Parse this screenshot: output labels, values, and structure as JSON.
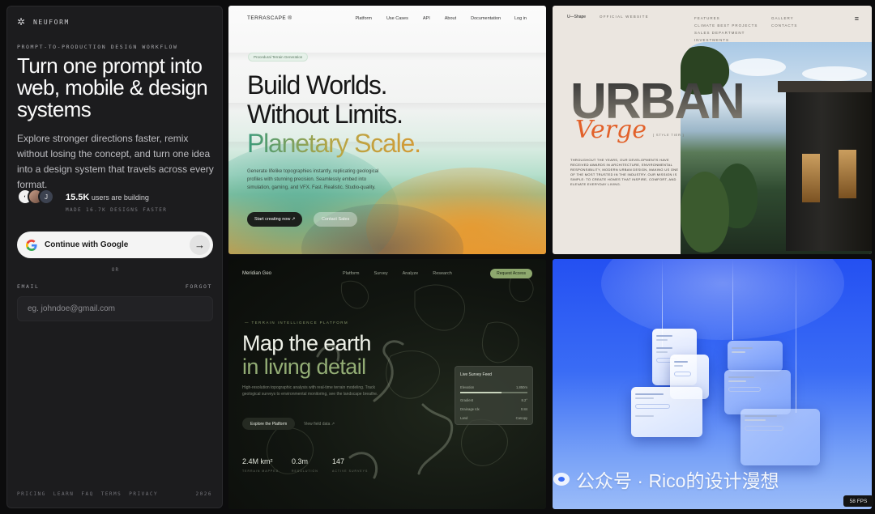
{
  "signin": {
    "brand_name": "NEUFORM",
    "eyebrow": "PROMPT-TO-PRODUCTION DESIGN WORKFLOW",
    "headline": "Turn one prompt into web, mobile & design systems",
    "description": "Explore stronger directions faster, remix without losing the concept, and turn one idea into a design system that travels across every format.",
    "avatar_initial": "J",
    "users_count": "15.5K",
    "users_suffix": " users are building",
    "users_sub": "MADE 16.7K DESIGNS FASTER",
    "google_label": "Continue with Google",
    "or_label": "OR",
    "email_label": "EMAIL",
    "forgot_label": "FORGOT",
    "email_placeholder": "eg. johndoe@gmail.com",
    "footer_links": [
      "PRICING",
      "LEARN",
      "FAQ",
      "TERMS",
      "PRIVACY"
    ],
    "footer_year": "2026"
  },
  "terrascape": {
    "logo": "TERRASCAPE ®",
    "nav": [
      "Platform",
      "Use Cases",
      "API",
      "About",
      "Documentation"
    ],
    "login": "Log in",
    "chip": "Procedural Terrain Generation",
    "line1": "Build Worlds.",
    "line2": "Without Limits.",
    "line3": "Planetary Scale.",
    "body": "Generate lifelike topographies instantly, replicating geological profiles with stunning precision. Seamlessly embed into simulation, gaming, and VFX. Fast. Realistic. Studio-quality.",
    "cta_primary": "Start creating now ↗",
    "cta_secondary": "Contact Sales"
  },
  "urban": {
    "logo": "U—Shape",
    "site_label": "OFFICIAL WEBSITE",
    "menu_col1": [
      "FEATURES",
      "CLIMATE BEST PROJECTS",
      "SALES DEPARTMENT",
      "INVESTMENTS"
    ],
    "menu_col2": [
      "GALLERY",
      "CONTACTS"
    ],
    "title": "URBAN",
    "subtitle": "Verge",
    "tag": "[ STYLE TIER ]",
    "body": "THROUGHOUT THE YEARS, OUR DEVELOPMENTS HAVE RECEIVED AWARDS IN ARCHITECTURE, ENVIRONMENTAL RESPONSIBILITY, MODERN URBAN DESIGN, MAKING US ONE OF THE MOST TRUSTED IN THE INDUSTRY. OUR MISSION IS SIMPLE: TO CREATE HOMES THAT INSPIRE, COMFORT, AND ELEVATE EVERYDAY LIVING."
  },
  "meridian": {
    "logo": "Meridian Geo",
    "nav": [
      "Platform",
      "Survey",
      "Analyze",
      "Research"
    ],
    "cta": "Request Access",
    "eyebrow": "— TERRAIN INTELLIGENCE PLATFORM",
    "line1": "Map the earth",
    "line2": "in living detail",
    "body": "High-resolution topographic analysis with real-time terrain modeling. Track geological surveys to environmental monitoring, see the landscape breathe.",
    "btn_primary": "Explore the Platform",
    "btn_secondary": "View field data ↗",
    "stats": [
      {
        "value": "2.4M km²",
        "label": "TERRAIN MAPPED"
      },
      {
        "value": "0.3m",
        "label": "RESOLUTION"
      },
      {
        "value": "147",
        "label": "ACTIVE SURVEYS"
      }
    ],
    "card_title": "Live Survey Feed",
    "card_rows": [
      {
        "k": "Elevation",
        "v": "1,850m"
      },
      {
        "k": "Gradient",
        "v": "8.2°"
      },
      {
        "k": "Drainage Idx",
        "v": "0.84"
      },
      {
        "k": "Land",
        "v": "Canopy"
      }
    ]
  },
  "overlay": {
    "watermark": "公众号 · Rico的设计漫想",
    "fps": "58 FPS"
  }
}
